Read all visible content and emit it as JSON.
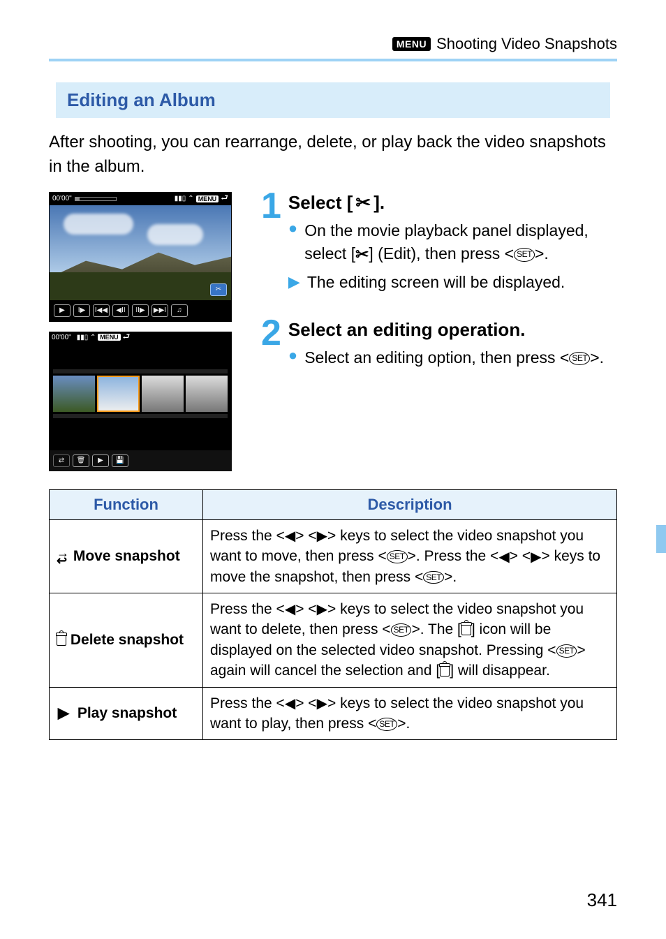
{
  "header": {
    "menu_chip": "MENU",
    "title": "Shooting Video Snapshots"
  },
  "section_title": "Editing an Album",
  "intro": "After shooting, you can rearrange, delete, or play back the video snapshots in the album.",
  "shot1": {
    "time": "00'00\"",
    "menu_chip": "MENU"
  },
  "shot2": {
    "time": "00'00\"",
    "menu_chip": "MENU"
  },
  "step1": {
    "number": "1",
    "title_pre": "Select [",
    "title_post": "].",
    "bullet1_a": "On the movie playback panel displayed, select [",
    "bullet1_b": "] (Edit), then press <",
    "bullet1_c": ">.",
    "bullet2": "The editing screen will be displayed."
  },
  "step2": {
    "number": "2",
    "title": "Select an editing operation.",
    "bullet1_a": "Select an editing option, then press <",
    "bullet1_b": ">."
  },
  "table": {
    "head_function": "Function",
    "head_description": "Description",
    "rows": [
      {
        "icon": "move",
        "label": "Move snapshot",
        "desc_parts": {
          "a": "Press the <",
          "b": "> <",
          "c": "> keys to select the video snapshot you want to move, then press <",
          "d": ">. Press the <",
          "e": "> <",
          "f": "> keys to move the snapshot, then press <",
          "g": ">."
        }
      },
      {
        "icon": "trash",
        "label": "Delete snapshot",
        "desc_parts": {
          "a": "Press the <",
          "b": "> <",
          "c": "> keys to select the video snapshot you want to delete, then press <",
          "d": ">. The [",
          "e": "] icon will be displayed on the selected video snapshot. Pressing <",
          "f": "> again will cancel the selection and [",
          "g": "] will disappear."
        }
      },
      {
        "icon": "play",
        "label": "Play snapshot",
        "desc_parts": {
          "a": "Press the <",
          "b": "> <",
          "c": "> keys to select the video snapshot you want to play, then press <",
          "d": ">."
        }
      }
    ]
  },
  "page_number": "341"
}
